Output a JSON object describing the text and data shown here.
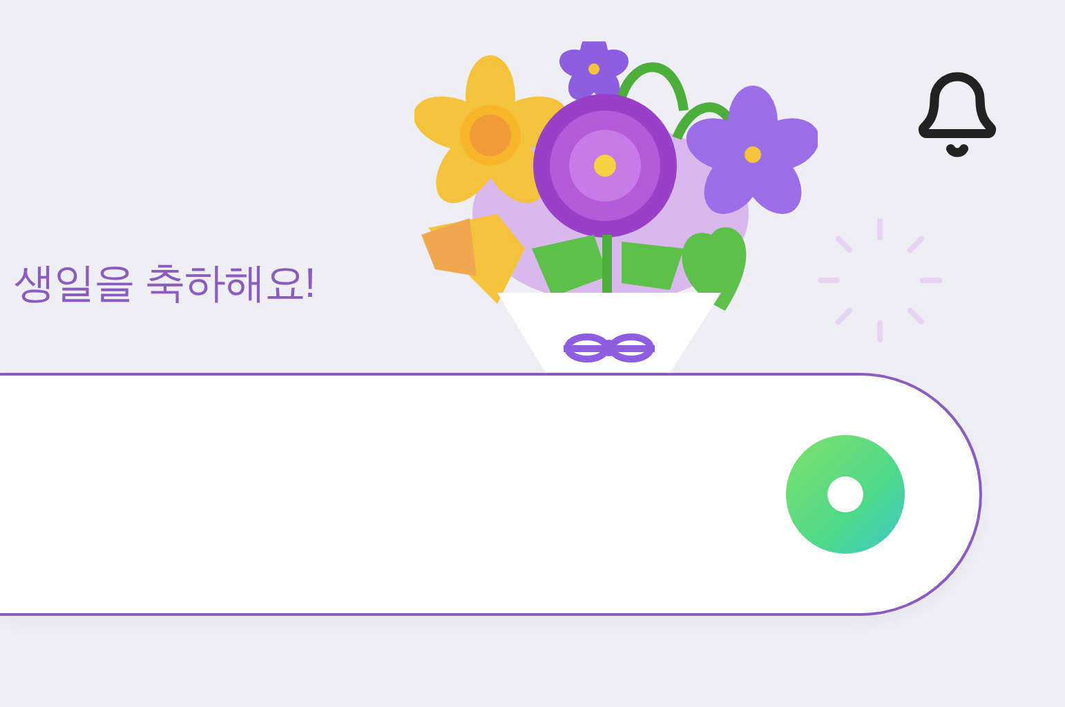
{
  "greeting": "생일을 축하해요!"
}
